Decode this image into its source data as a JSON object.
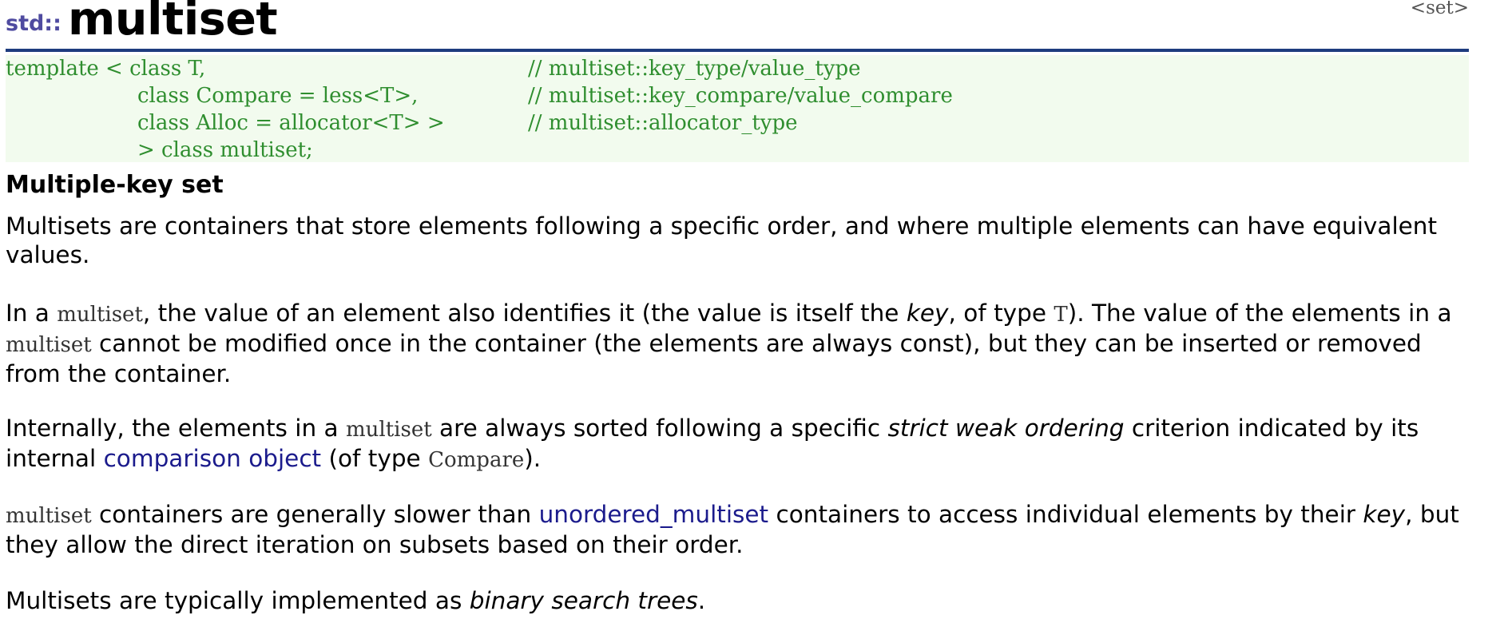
{
  "title": {
    "namespace": "std::",
    "class_name": "multiset",
    "header_ref": "<set>"
  },
  "declaration": {
    "l1_code": "template < class T,",
    "l1_comment": "// multiset::key_type/value_type",
    "l2_code": "class Compare = less<T>,",
    "l2_comment": "// multiset::key_compare/value_compare",
    "l3_code": "class Alloc = allocator<T> >",
    "l3_comment": "// multiset::allocator_type",
    "l4_code": "> class multiset;"
  },
  "heading": "Multiple-key set",
  "p1": {
    "text": "Multisets are containers that store elements following a specific order, and where multiple elements can have equivalent values."
  },
  "p2": {
    "a": "In a ",
    "code1": "multiset",
    "b": ", the value of an element also identifies it (the value is itself the ",
    "em1": "key",
    "c": ", of type ",
    "code2": "T",
    "d": "). The value of the elements in a ",
    "code3": "multiset",
    "e": " cannot be modified once in the container (the elements are always const), but they can be inserted or removed from the container."
  },
  "p3": {
    "a": "Internally, the elements in a ",
    "code1": "multiset",
    "b": " are always sorted following a specific ",
    "em1": "strict weak ordering",
    "c": " criterion indicated by its internal ",
    "link1": "comparison object",
    "d": " (of type ",
    "code2": "Compare",
    "e": ")."
  },
  "p4": {
    "code1": "multiset",
    "a": " containers are generally slower than ",
    "link1": "unordered_multiset",
    "b": " containers to access individual elements by their ",
    "em1": "key",
    "c": ", but they allow the direct iteration on subsets based on their order."
  },
  "p5": {
    "a": "Multisets are typically implemented as ",
    "em1": "binary search trees",
    "b": "."
  }
}
